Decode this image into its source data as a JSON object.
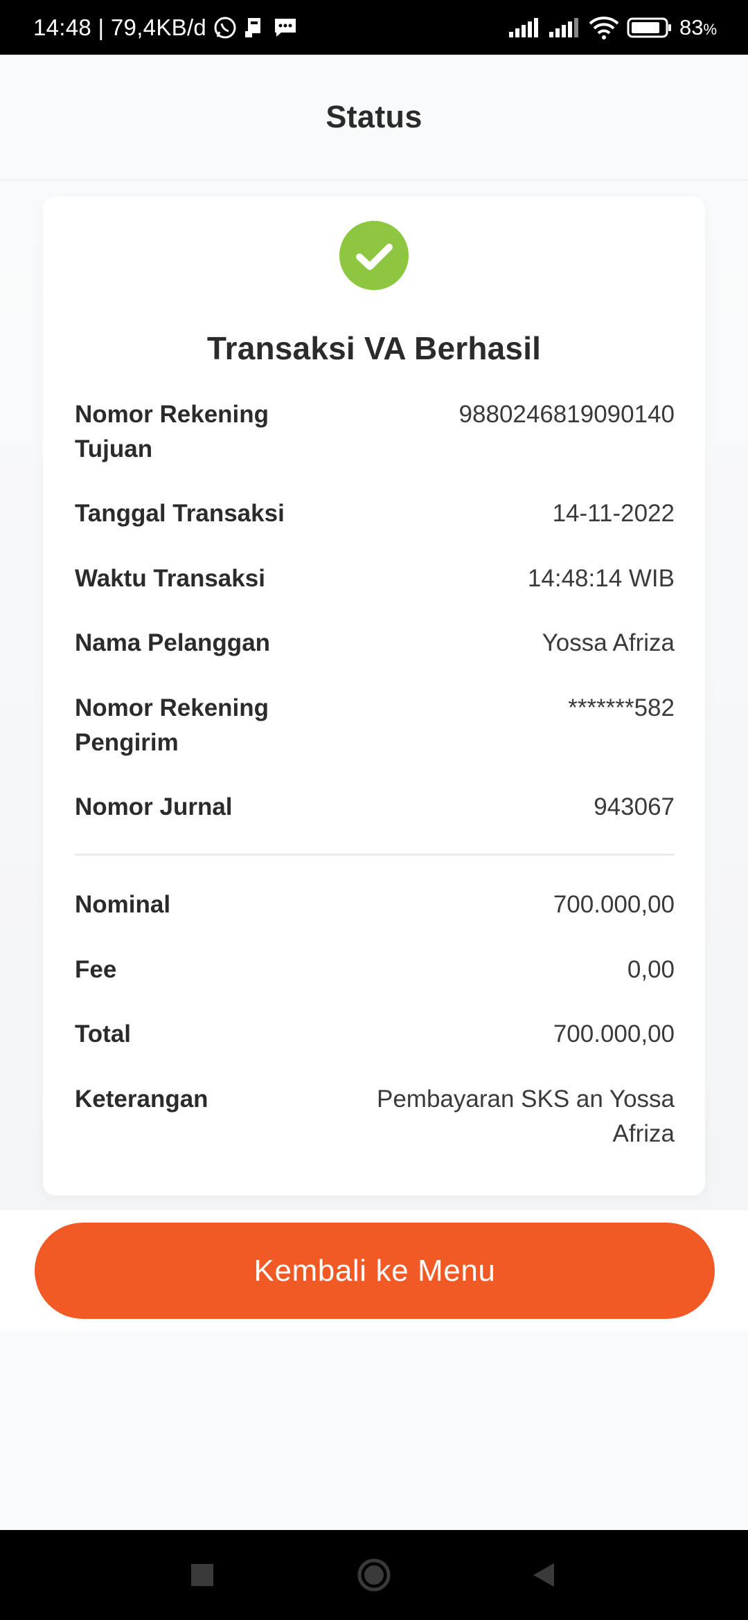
{
  "status_bar": {
    "time_info": "14:48 | 79,4KB/d",
    "battery": "83",
    "battery_unit": "%"
  },
  "header": {
    "title": "Status"
  },
  "receipt": {
    "title": "Transaksi VA Berhasil",
    "rows": [
      {
        "label": "Nomor Rekening Tujuan",
        "value": "9880246819090140"
      },
      {
        "label": "Tanggal Transaksi",
        "value": "14-11-2022"
      },
      {
        "label": "Waktu Transaksi",
        "value": "14:48:14 WIB"
      },
      {
        "label": "Nama Pelanggan",
        "value": "Yossa Afriza"
      },
      {
        "label": "Nomor Rekening Pengirim",
        "value": "*******582"
      },
      {
        "label": "Nomor Jurnal",
        "value": "943067"
      }
    ],
    "amounts": [
      {
        "label": "Nominal",
        "value": "700.000,00"
      },
      {
        "label": "Fee",
        "value": "0,00"
      },
      {
        "label": "Total",
        "value": "700.000,00"
      },
      {
        "label": "Keterangan",
        "value": "Pembayaran SKS an Yossa Afriza"
      }
    ]
  },
  "button": {
    "label": "Kembali ke Menu"
  },
  "colors": {
    "accent": "#f15a24",
    "success": "#8dc63f"
  },
  "icons": [
    "whatsapp-icon",
    "sim-icon",
    "message-icon",
    "signal-icon",
    "wifi-icon",
    "battery-icon",
    "check-circle-icon",
    "recents-icon",
    "home-icon",
    "back-icon"
  ]
}
